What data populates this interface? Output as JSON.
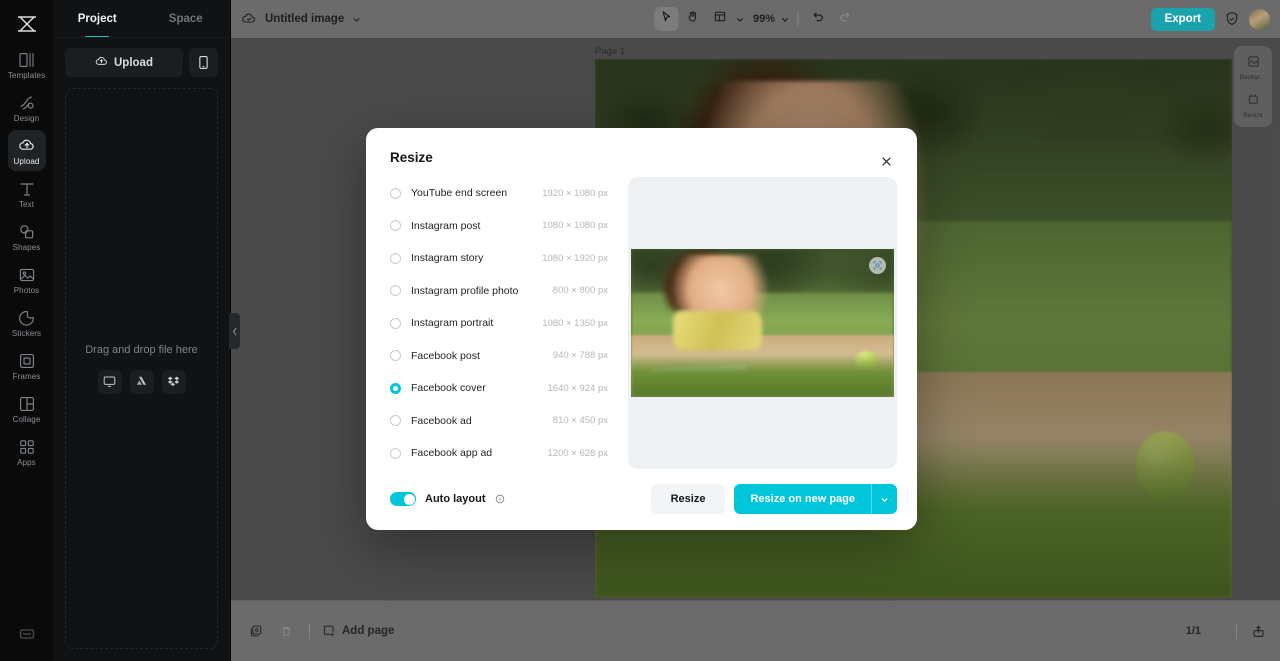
{
  "rail": {
    "logo_icon": "app-logo-icon",
    "items": [
      {
        "label": "Templates",
        "icon": "templates-icon",
        "active": false
      },
      {
        "label": "Design",
        "icon": "design-icon",
        "active": false
      },
      {
        "label": "Upload",
        "icon": "upload-cloud-icon",
        "active": true
      },
      {
        "label": "Text",
        "icon": "text-icon",
        "active": false
      },
      {
        "label": "Shapes",
        "icon": "shapes-icon",
        "active": false
      },
      {
        "label": "Photos",
        "icon": "photos-icon",
        "active": false
      },
      {
        "label": "Stickers",
        "icon": "stickers-icon",
        "active": false
      },
      {
        "label": "Frames",
        "icon": "frames-icon",
        "active": false
      },
      {
        "label": "Collage",
        "icon": "collage-icon",
        "active": false
      },
      {
        "label": "Apps",
        "icon": "apps-grid-icon",
        "active": false
      }
    ],
    "bottom_icon": "toolbar-toggle-icon"
  },
  "panel": {
    "tabs": [
      {
        "label": "Project",
        "active": true
      },
      {
        "label": "Space",
        "active": false
      }
    ],
    "upload_label": "Upload",
    "upload_icon": "upload-cloud-icon",
    "mobile_icon": "mobile-phone-icon",
    "dropzone_text": "Drag and drop file here",
    "sources": [
      {
        "name": "computer-icon"
      },
      {
        "name": "google-drive-icon"
      },
      {
        "name": "dropbox-icon"
      }
    ],
    "collapse_icon": "chevron-left-icon"
  },
  "topbar": {
    "cloud_icon": "cloud-saved-icon",
    "doc_title": "Untitled image",
    "title_caret": "chevron-down-icon",
    "tools": [
      {
        "name": "select-tool",
        "icon": "cursor-arrow-icon",
        "selected": true
      },
      {
        "name": "hand-tool",
        "icon": "hand-icon",
        "selected": false
      },
      {
        "name": "layout-tool",
        "icon": "layout-grid-icon",
        "selected": false
      }
    ],
    "layout_caret": "chevron-down-icon",
    "zoom_value": "99%",
    "zoom_caret": "chevron-down-icon",
    "undo_icon": "undo-icon",
    "redo_icon": "redo-icon",
    "export_label": "Export",
    "shield_icon": "shield-check-icon",
    "avatar": "user-avatar"
  },
  "canvas": {
    "page_label": "Page 1"
  },
  "right_tools": [
    {
      "label": "Backgr…",
      "icon": "background-icon"
    },
    {
      "label": "Resize",
      "icon": "resize-icon"
    }
  ],
  "bottombar": {
    "duplicate_icon": "duplicate-page-icon",
    "delete_icon": "trash-icon",
    "add_page_icon": "add-page-icon",
    "add_page_label": "Add page",
    "prev_icon": "chevron-left-icon",
    "page_indicator": "1/1",
    "next_icon": "chevron-right-icon",
    "export_icon": "export-upload-icon"
  },
  "modal": {
    "title": "Resize",
    "close_icon": "close-icon",
    "options": [
      {
        "label": "YouTube end screen",
        "dimensions": "1920 × 1080 px",
        "selected": false
      },
      {
        "label": "Instagram post",
        "dimensions": "1080 × 1080 px",
        "selected": false
      },
      {
        "label": "Instagram story",
        "dimensions": "1080 × 1920 px",
        "selected": false
      },
      {
        "label": "Instagram profile photo",
        "dimensions": "800 × 800 px",
        "selected": false
      },
      {
        "label": "Instagram portrait",
        "dimensions": "1080 × 1350 px",
        "selected": false
      },
      {
        "label": "Facebook post",
        "dimensions": "940 × 788 px",
        "selected": false
      },
      {
        "label": "Facebook cover",
        "dimensions": "1640 × 924 px",
        "selected": true
      },
      {
        "label": "Facebook ad",
        "dimensions": "810 × 450 px",
        "selected": false
      },
      {
        "label": "Facebook app ad",
        "dimensions": "1200 × 628 px",
        "selected": false
      }
    ],
    "preview_badge_icon": "smart-focus-icon",
    "auto_layout_label": "Auto layout",
    "auto_layout_info_icon": "info-icon",
    "auto_layout_on": true,
    "secondary_button": "Resize",
    "primary_button": "Resize on new page",
    "primary_caret_icon": "chevron-down-icon"
  },
  "colors": {
    "accent_cyan": "#00c6dc",
    "teal_export": "#1aa3ad",
    "tab_underline": "#19b9c6"
  }
}
